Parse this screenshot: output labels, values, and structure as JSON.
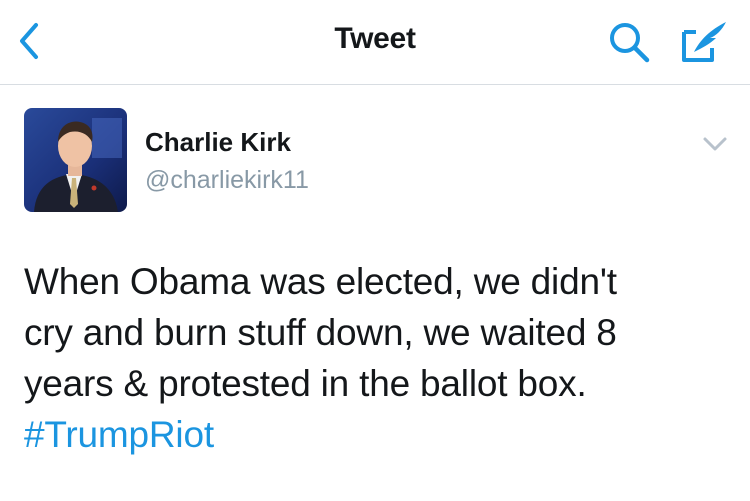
{
  "nav": {
    "title": "Tweet",
    "back_icon": "chevron-left-icon",
    "search_icon": "search-icon",
    "compose_icon": "compose-icon"
  },
  "tweet": {
    "author": {
      "display_name": "Charlie Kirk",
      "handle": "@charliekirk11"
    },
    "text_lines": [
      "When Obama was elected, we didn't",
      "cry and burn stuff down, we waited 8",
      "years & protested in the ballot box."
    ],
    "hashtag": "#TrumpRiot",
    "menu_icon": "chevron-down-icon"
  },
  "colors": {
    "accent": "#1b95e0",
    "text": "#14171a",
    "secondary": "#8899a6",
    "divider": "#d8dde2"
  }
}
